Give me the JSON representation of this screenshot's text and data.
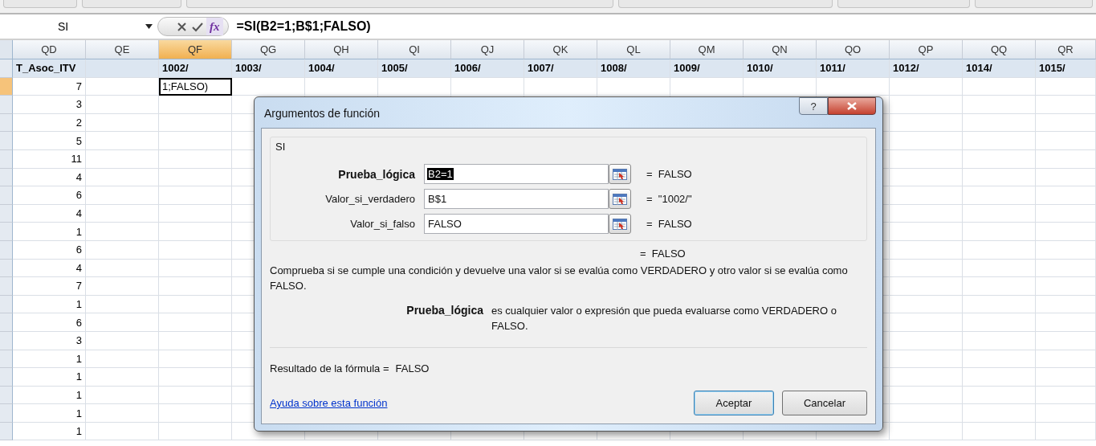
{
  "formula_bar": {
    "name_box": "SI",
    "function_button": "fx",
    "formula": "=SI(B2=1;B$1;FALSO)"
  },
  "sheet": {
    "columns": [
      {
        "label": "QD",
        "selected": false
      },
      {
        "label": "QE",
        "selected": false
      },
      {
        "label": "QF",
        "selected": true
      },
      {
        "label": "QG",
        "selected": false
      },
      {
        "label": "QH",
        "selected": false
      },
      {
        "label": "QI",
        "selected": false
      },
      {
        "label": "QJ",
        "selected": false
      },
      {
        "label": "QK",
        "selected": false
      },
      {
        "label": "QL",
        "selected": false
      },
      {
        "label": "QM",
        "selected": false
      },
      {
        "label": "QN",
        "selected": false
      },
      {
        "label": "QO",
        "selected": false
      },
      {
        "label": "QP",
        "selected": false
      },
      {
        "label": "QQ",
        "selected": false
      },
      {
        "label": "QR",
        "selected": false
      }
    ],
    "title_row": {
      "first": "T_Asoc_ITV",
      "from_third": [
        "1002/",
        "1003/",
        "1004/",
        "1005/",
        "1006/",
        "1007/",
        "1008/",
        "1009/",
        "1010/",
        "1011/",
        "1012/",
        "1014/",
        "1015/"
      ]
    },
    "rows": [
      {
        "value": "7",
        "selected": true,
        "editing_text": "1;FALSO)"
      },
      {
        "value": "3",
        "selected": false
      },
      {
        "value": "2",
        "selected": false
      },
      {
        "value": "5",
        "selected": false
      },
      {
        "value": "11",
        "selected": false
      },
      {
        "value": "4",
        "selected": false
      },
      {
        "value": "6",
        "selected": false
      },
      {
        "value": "4",
        "selected": false
      },
      {
        "value": "1",
        "selected": false
      },
      {
        "value": "6",
        "selected": false
      },
      {
        "value": "4",
        "selected": false
      },
      {
        "value": "7",
        "selected": false
      },
      {
        "value": "1",
        "selected": false
      },
      {
        "value": "6",
        "selected": false
      },
      {
        "value": "3",
        "selected": false
      },
      {
        "value": "1",
        "selected": false
      },
      {
        "value": "1",
        "selected": false
      },
      {
        "value": "1",
        "selected": false
      },
      {
        "value": "1",
        "selected": false
      },
      {
        "value": "1",
        "selected": false
      }
    ]
  },
  "dialog": {
    "title": "Argumentos de función",
    "help_button": "?",
    "function_name": "SI",
    "arguments": [
      {
        "label": "Prueba_lógica",
        "value": "B2=1",
        "result": "=  FALSO",
        "selected": true
      },
      {
        "label": "Valor_si_verdadero",
        "value": "B$1",
        "result": "=  \"1002/\"",
        "selected": false
      },
      {
        "label": "Valor_si_falso",
        "value": "FALSO",
        "result": "=  FALSO",
        "selected": false
      }
    ],
    "overall_result": "=  FALSO",
    "description": "Comprueba si se cumple una condición y devuelve una valor si se evalúa como VERDADERO y otro valor si se evalúa como FALSO.",
    "argument_help": {
      "name": "Prueba_lógica",
      "text": "es cualquier valor o expresión que pueda evaluarse como VERDADERO o FALSO."
    },
    "formula_result_label": "Resultado de la fórmula =",
    "formula_result": "FALSO",
    "help_link": "Ayuda sobre esta función",
    "buttons": [
      {
        "label": "Aceptar",
        "default": true
      },
      {
        "label": "Cancelar",
        "default": false
      }
    ]
  }
}
